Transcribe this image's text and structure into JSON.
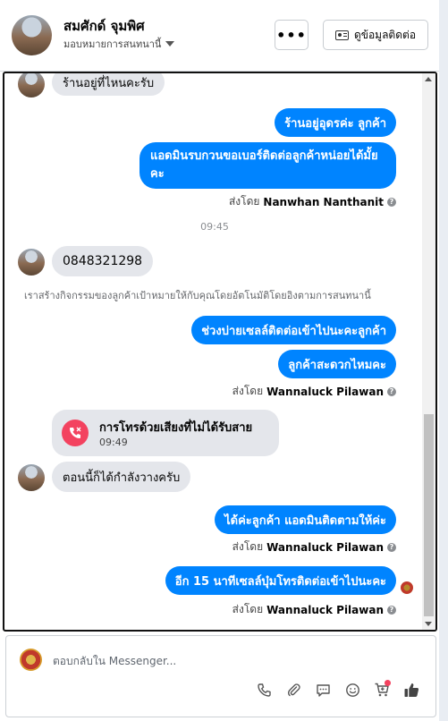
{
  "header": {
    "name": "สมศักด์ จุมพิศ",
    "assigned": "มอบหมายการสนทนานี้",
    "more_label": "•••",
    "contact_button": "ดูข้อมูลติดต่อ"
  },
  "messages": {
    "m1": "ร้านอยู่ที่ไหนคะรับ",
    "m2": "ร้านอยู่อุดรค่ะ ลูกค้า",
    "m3": "แอดมินรบกวนขอเบอร์ติดต่อลูกค้าหน่อยได้มั้ยคะ",
    "sent1_prefix": "ส่งโดย",
    "sent1_name": "Nanwhan Nanthanit",
    "time1": "09:45",
    "m4": "0848321298",
    "activity": "เราสร้างกิจกรรมของลูกค้าเป้าหมายให้กับคุณโดยอัตโนมัติโดยอิงตามการสนทนานี้",
    "m5": "ช่วงบ่ายเซลล์ติดต่อเข้าไปนะคะลูกค้า",
    "m6": "ลูกค้าสะดวกไหมคะ",
    "sent2_prefix": "ส่งโดย",
    "sent2_name": "Wannaluck Pilawan",
    "call_title": "การโทรด้วยเสียงที่ไม่ได้รับสาย",
    "call_time": "09:49",
    "m7": "ตอนนี้ก็ได้กำลังวางครับ",
    "m8": "ได้ค่ะลูกค้า แอดมินติดตามให้ค่ะ",
    "sent3_prefix": "ส่งโดย",
    "sent3_name": "Wannaluck Pilawan",
    "m9": "อีก 15 นาทีเซลล์บุ๋มโทรติดต่อเข้าไปนะคะ",
    "sent4_prefix": "ส่งโดย",
    "sent4_name": "Wannaluck Pilawan"
  },
  "composer": {
    "placeholder": "ตอบกลับใน Messenger..."
  },
  "colors": {
    "outgoing": "#0084ff",
    "incoming": "#e4e6eb",
    "missed_call": "#f3425f"
  },
  "icons": [
    "phone-icon",
    "attachment-icon",
    "saved-reply-icon",
    "emoji-icon",
    "cart-icon",
    "like-icon"
  ]
}
